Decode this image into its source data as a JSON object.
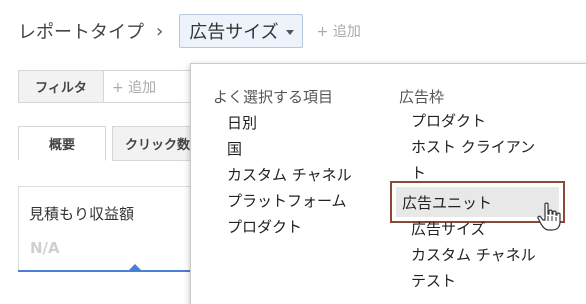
{
  "breadcrumb": {
    "title": "レポートタイプ",
    "separator": "›",
    "dropdown_label": "広告サイズ",
    "add_label": "+ 追加"
  },
  "filter": {
    "button_label": "フィルタ",
    "add_placeholder": "+ 追加"
  },
  "tabs": [
    {
      "label": "概要",
      "active": true
    },
    {
      "label": "クリック数",
      "active": false
    }
  ],
  "card": {
    "title": "見積もり収益額",
    "value": "N/A",
    "accent_color": "#4a7fd8"
  },
  "menu": {
    "columns": [
      {
        "heading": "よく選択する項目",
        "items": [
          "日別",
          "国",
          "カスタム チャネル",
          "プラットフォーム",
          "プロダクト"
        ]
      },
      {
        "heading": "広告枠",
        "items": [
          "プロダクト",
          "ホスト クライアン",
          "ト",
          "広告ユニット",
          "広告サイズ",
          "カスタム チャネル",
          "テスト"
        ]
      }
    ],
    "highlighted_item": "広告ユニット",
    "highlight_color": "#8a4a3a"
  },
  "cursor": {
    "icon": "hand-pointer-icon"
  }
}
